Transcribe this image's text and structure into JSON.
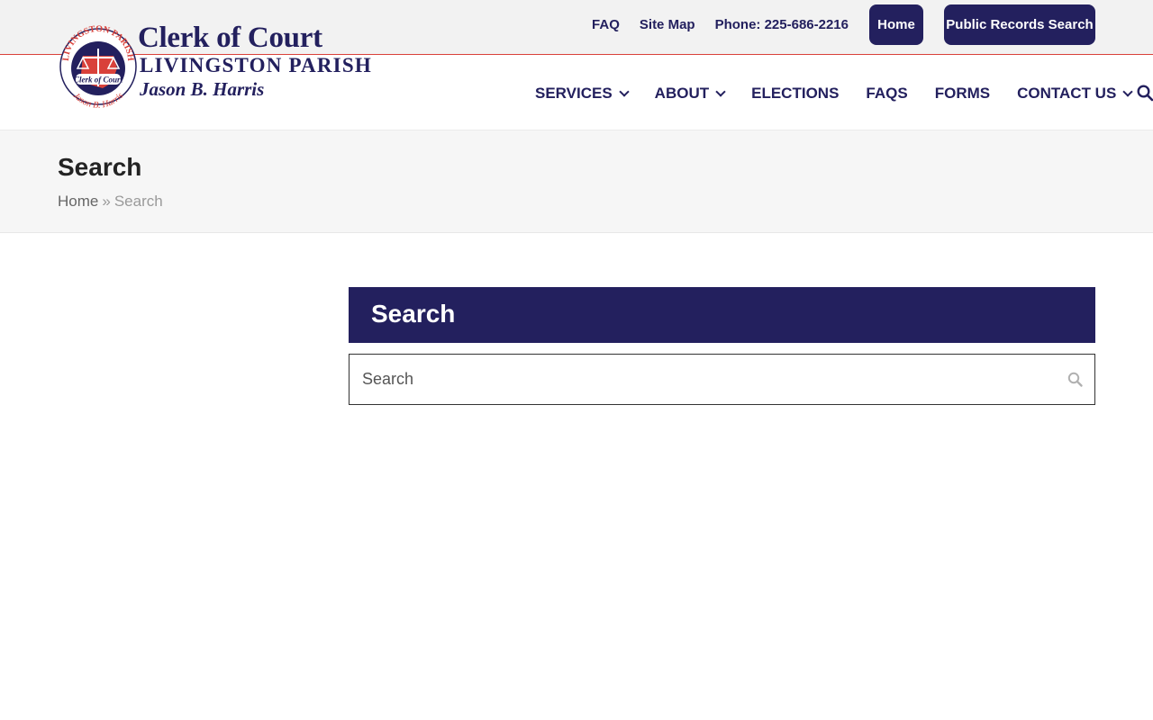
{
  "topbar": {
    "links": [
      {
        "label": "FAQ"
      },
      {
        "label": "Site Map"
      },
      {
        "label": "Phone: 225-686-2216"
      }
    ],
    "home_button": "Home",
    "records_button": "Public Records Search"
  },
  "logo": {
    "title": "Clerk of Court",
    "subtitle": "LIVINGSTON PARISH",
    "name": "Jason B. Harris",
    "seal_top": "LIVINGSTON PARISH",
    "seal_center": "Clerk of Court",
    "seal_bottom": "Jason B. Harris",
    "seal_icon": "scales-of-justice-icon"
  },
  "nav": {
    "items": [
      {
        "label": "SERVICES",
        "dropdown": true
      },
      {
        "label": "ABOUT",
        "dropdown": true
      },
      {
        "label": "ELECTIONS",
        "dropdown": false
      },
      {
        "label": "FAQS",
        "dropdown": false
      },
      {
        "label": "FORMS",
        "dropdown": false
      },
      {
        "label": "CONTACT US",
        "dropdown": true
      }
    ],
    "search_icon": "search-icon"
  },
  "page": {
    "title": "Search",
    "breadcrumb": {
      "home": "Home",
      "separator": "»",
      "current": "Search"
    }
  },
  "widget": {
    "title": "Search",
    "search_placeholder": "Search",
    "search_icon": "search-icon"
  },
  "colors": {
    "brand_navy": "#23205e",
    "accent_red": "#d9413a",
    "topbar_bg": "#f2f2f2",
    "titlebar_bg": "#f6f6f6"
  }
}
